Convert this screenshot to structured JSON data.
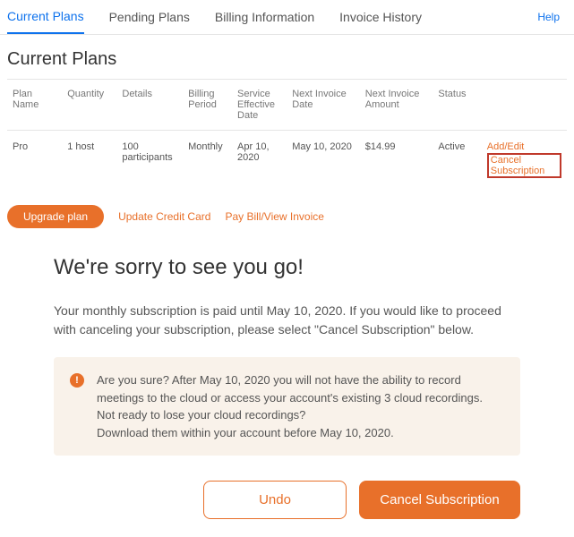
{
  "tabs": {
    "current": "Current Plans",
    "pending": "Pending Plans",
    "billing": "Billing Information",
    "invoice": "Invoice History",
    "help": "Help"
  },
  "page_title": "Current Plans",
  "headers": {
    "plan": "Plan Name",
    "qty": "Quantity",
    "details": "Details",
    "billing": "Billing Period",
    "effective": "Service Effective Date",
    "next_date": "Next Invoice Date",
    "next_amt": "Next Invoice Amount",
    "status": "Status"
  },
  "row": {
    "plan": "Pro",
    "qty": "1 host",
    "details": "100 participants",
    "billing": "Monthly",
    "effective": "Apr 10, 2020",
    "next_date": "May 10, 2020",
    "next_amt": "$14.99",
    "status": "Active",
    "add_edit": "Add/Edit",
    "cancel_sub": "Cancel Subscription"
  },
  "actions": {
    "upgrade": "Upgrade plan",
    "update_card": "Update Credit Card",
    "pay_bill": "Pay Bill/View Invoice"
  },
  "cancel": {
    "title": "We're sorry to see you go!",
    "body": "Your monthly subscription is paid until May 10, 2020. If you would like to proceed with canceling your subscription, please select \"Cancel Subscription\" below.",
    "warn1": "Are you sure? After May 10, 2020 you will not have the ability to record meetings to the cloud or access your account's existing 3 cloud recordings.",
    "warn2": "Not ready to lose your cloud recordings?",
    "warn3": "Download them within your account before May 10, 2020.",
    "undo": "Undo",
    "confirm": "Cancel Subscription"
  }
}
